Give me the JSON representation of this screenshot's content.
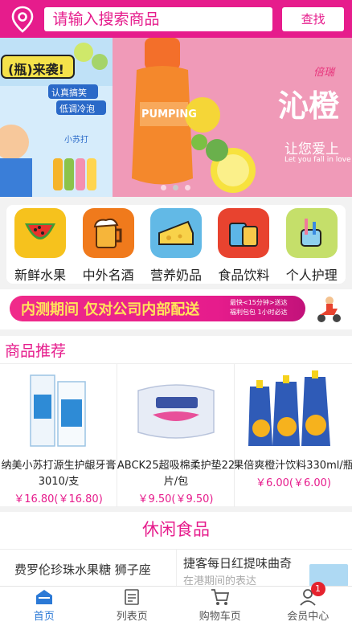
{
  "header": {
    "search_placeholder": "请输入搜索商品",
    "search_button": "查找",
    "brand_color": "#e61c8c"
  },
  "banner": {
    "left_headline": "(瓶)来袭!",
    "left_badge_1": "小苏打",
    "left_badge_2": "认真搞笑",
    "left_badge_3": "低调冷泡",
    "right_brand": "倍瑞",
    "right_headline": "沁橙",
    "right_sub_1": "让您爱上",
    "right_sub_2": "Let you fall in love with",
    "product_text": "PUMPING",
    "slide_count": 3,
    "active_slide": 1
  },
  "categories": [
    {
      "label": "新鲜水果",
      "icon": "watermelon-icon",
      "color": "#f6c21d"
    },
    {
      "label": "中外名酒",
      "icon": "beer-mug-icon",
      "color": "#f07a1c"
    },
    {
      "label": "营养奶品",
      "icon": "cheese-icon",
      "color": "#62b9e6"
    },
    {
      "label": "食品饮料",
      "icon": "snacks-icon",
      "color": "#e8432f"
    },
    {
      "label": "个人护理",
      "icon": "toothbrush-icon",
      "color": "#c5df6a"
    }
  ],
  "promo": {
    "text": "内测期间 仅对公司内部配送",
    "side_line_1": "最快<15分钟>送达",
    "side_line_2": "福利包包 1小时必达"
  },
  "recommend": {
    "title": "商品推荐",
    "products": [
      {
        "name": "纳美小苏打源生护龈牙膏3010/支",
        "price": "￥16.80(￥16.80)",
        "icon": "toothpaste-icon"
      },
      {
        "name": "ABCK25超吸棉柔护垫22片/包",
        "price": "￥9.50(￥9.50)",
        "icon": "pad-pack-icon"
      },
      {
        "name": "果倍爽橙汁饮料330ml/瓶",
        "price": "￥6.00(￥6.00)",
        "icon": "juice-pouch-icon"
      }
    ]
  },
  "leisure": {
    "title": "休闲食品",
    "item_1": "费罗伦珍珠水果糖 狮子座",
    "item_2": "捷客每日红提味曲奇",
    "item_2_sub": "在港期间的表达"
  },
  "nav": [
    {
      "label": "首页",
      "icon": "home-icon",
      "active": true
    },
    {
      "label": "列表页",
      "icon": "list-icon",
      "active": false
    },
    {
      "label": "购物车页",
      "icon": "cart-icon",
      "active": false
    },
    {
      "label": "会员中心",
      "icon": "user-icon",
      "active": false,
      "badge": "1"
    }
  ]
}
